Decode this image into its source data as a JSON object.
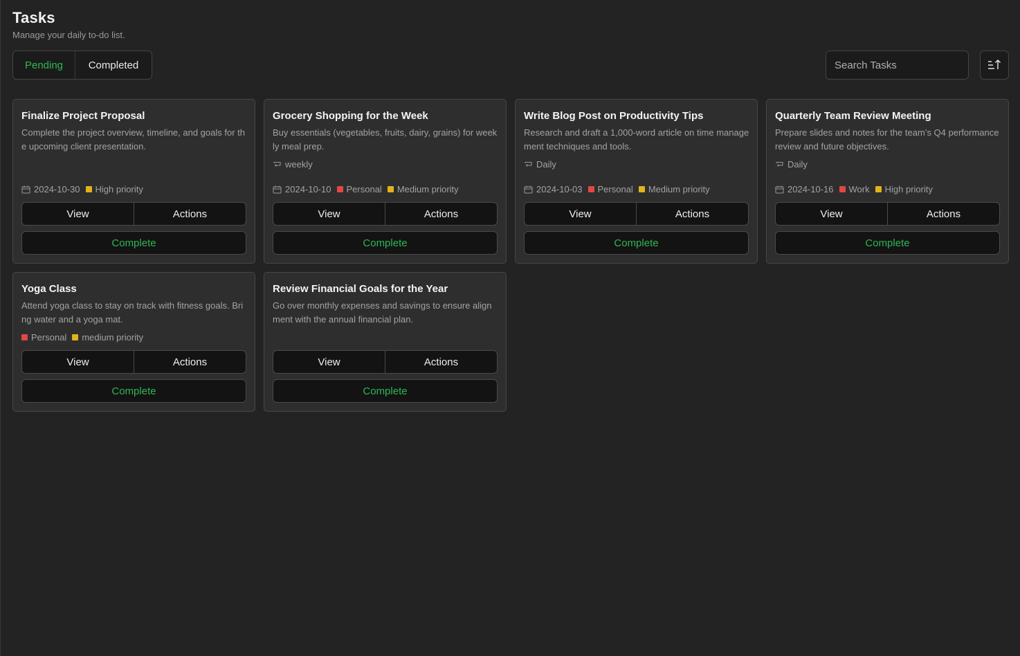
{
  "header": {
    "title": "Tasks",
    "subtitle": "Manage your daily to-do list."
  },
  "tabs": {
    "pending": "Pending",
    "completed": "Completed"
  },
  "search": {
    "placeholder": "Search Tasks"
  },
  "sort": {
    "icon": "sort-ascending-icon"
  },
  "colors": {
    "accent_green": "#2fb655",
    "tag_red": "#e64545",
    "priority_amber": "#e3b21b",
    "background": "#232323",
    "card": "#2e2e2e"
  },
  "buttons": {
    "view": "View",
    "actions": "Actions",
    "complete": "Complete"
  },
  "tasks": [
    {
      "title": "Finalize Project Proposal",
      "description": "Complete the project overview, timeline, and goals for the upcoming client presentation.",
      "date": "2024-10-30",
      "priority": "High priority"
    },
    {
      "title": "Grocery Shopping for the Week",
      "description": "Buy essentials (vegetables, fruits, dairy, grains) for weekly meal prep.",
      "recurrence": "weekly",
      "date": "2024-10-10",
      "tag": "Personal",
      "priority": "Medium priority"
    },
    {
      "title": "Write Blog Post on Productivity Tips",
      "description": "Research and draft a 1,000-word article on time management techniques and tools.",
      "recurrence": "Daily",
      "date": "2024-10-03",
      "tag": "Personal",
      "priority": "Medium priority"
    },
    {
      "title": "Quarterly Team Review Meeting",
      "description": "Prepare slides and notes for the team’s Q4 performance review and future objectives.",
      "recurrence": "Daily",
      "date": "2024-10-16",
      "tag": "Work",
      "priority": "High priority"
    },
    {
      "title": "Yoga Class",
      "description": "Attend yoga class to stay on track with fitness goals. Bring water and a yoga mat.",
      "tag": "Personal",
      "priority": "medium priority"
    },
    {
      "title": "Review Financial Goals for the Year",
      "description": "Go over monthly expenses and savings to ensure alignment with the annual financial plan."
    }
  ]
}
